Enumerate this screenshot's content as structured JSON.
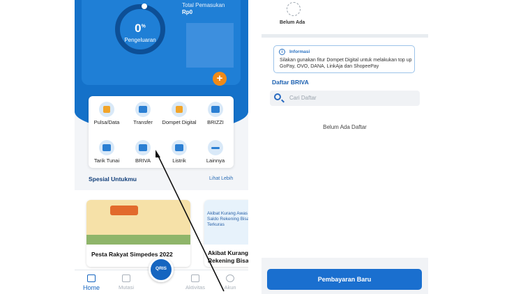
{
  "left": {
    "summary": {
      "percent": "0",
      "percent_sign": "%",
      "expense_label": "Pengeluaran",
      "income_title": "Total Pemasukan",
      "income_value": "Rp0"
    },
    "menu": [
      {
        "label": "Pulsa/Data",
        "icon": "phone-icon"
      },
      {
        "label": "Transfer",
        "icon": "transfer-icon"
      },
      {
        "label": "Dompet Digital",
        "icon": "wallet-icon"
      },
      {
        "label": "BRIZZI",
        "icon": "card-icon"
      },
      {
        "label": "Tarik Tunai",
        "icon": "atm-icon"
      },
      {
        "label": "BRIVA",
        "icon": "briva-icon"
      },
      {
        "label": "Listrik",
        "icon": "lightning-icon"
      },
      {
        "label": "Lainnya",
        "icon": "more-icon"
      }
    ],
    "special": {
      "title": "Spesial Untukmu",
      "see_more": "Lihat Lebih"
    },
    "promos": [
      {
        "title": "Pesta Rakyat Simpedes 2022"
      },
      {
        "title": "Akibat Kurang Rekening Bisa",
        "image_text": "Akibat Kurang Awas Saldo Rekening Bisa Terkuras"
      }
    ],
    "nav": {
      "home": "Home",
      "mutation": "Mutasi",
      "qris": "QRIS",
      "activity": "Aktivitas",
      "account": "Akun"
    }
  },
  "right": {
    "ewallet_empty": "Belum Ada",
    "info": {
      "title": "Informasi",
      "text": "Silakan gunakan fitur Dompet Digital untuk melakukan top up GoPay, OVO, DANA, LinkAja dan ShopeePay"
    },
    "list_title": "Daftar BRIVA",
    "search_placeholder": "Cari Daftar",
    "empty_list": "Belum Ada Daftar",
    "pay_button": "Pembayaran Baru"
  },
  "colors": {
    "primary": "#1471c9",
    "accent_orange": "#f08a17",
    "button_blue": "#1a6fcf"
  }
}
